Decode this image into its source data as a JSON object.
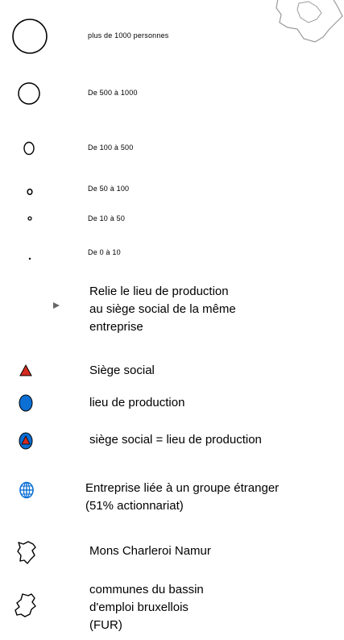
{
  "legend": {
    "size_classes": [
      {
        "label": "plus de 1000 personnes",
        "icon": "circle-xl-icon"
      },
      {
        "label": "De 500 à 1000",
        "icon": "circle-l-icon"
      },
      {
        "label": "De 100 à 500",
        "icon": "circle-m-icon"
      },
      {
        "label": "De 50 à 100",
        "icon": "circle-s-icon"
      },
      {
        "label": "De 10 à 50",
        "icon": "circle-xs-icon"
      },
      {
        "label": "De 0 à 10",
        "icon": "circle-xxs-icon"
      }
    ],
    "link": {
      "lines": [
        "Relie le lieu de production",
        "au siège social de la même",
        "entreprise"
      ],
      "icon": "arrow-head-icon"
    },
    "siege_social": {
      "label": "Siège social",
      "icon": "red-triangle-icon",
      "color": "#d42a1f"
    },
    "lieu_production": {
      "label": "lieu de production",
      "icon": "blue-dot-icon",
      "color": "#0b6fd4"
    },
    "both": {
      "label": "siège social = lieu de production",
      "icon": "blue-dot-red-triangle-icon"
    },
    "foreign": {
      "lines": [
        "Entreprise liée à un groupe étranger",
        "(51% actionnariat)"
      ],
      "icon": "globe-icon",
      "color": "#0b6fd4"
    },
    "mcn": {
      "label": "Mons Charleroi Namur",
      "icon": "region-outline-icon"
    },
    "bxl": {
      "lines": [
        "communes du bassin",
        "d'emploi bruxellois",
        "(FUR)"
      ],
      "icon": "region-outline-2-icon"
    }
  }
}
